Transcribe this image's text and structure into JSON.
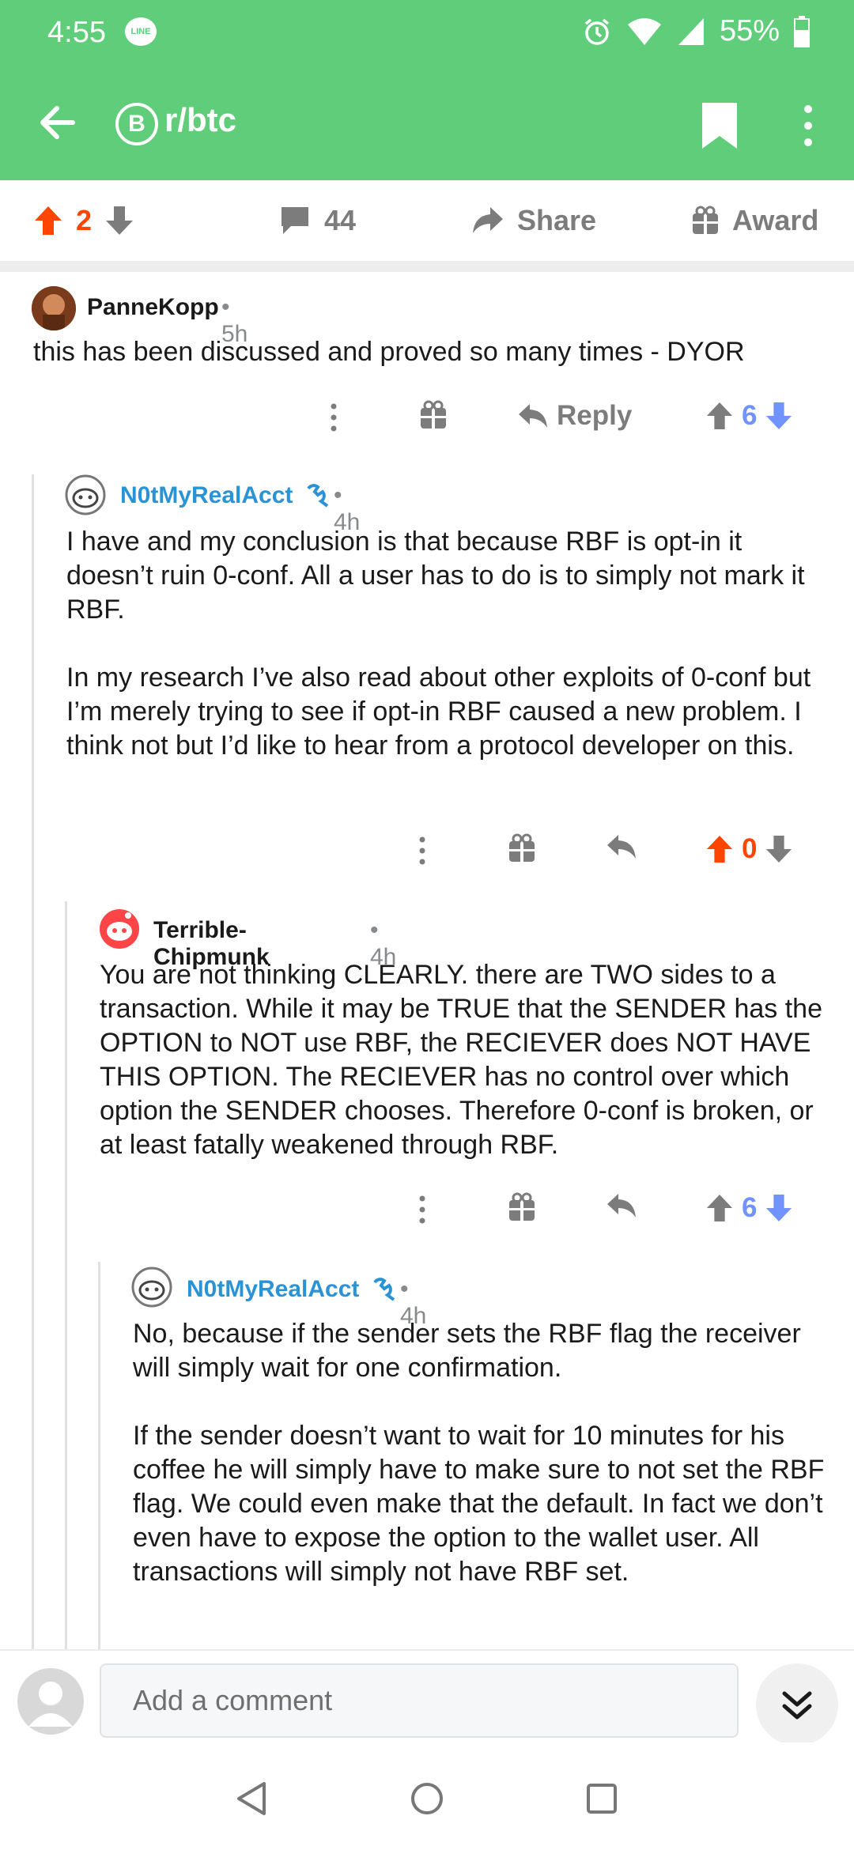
{
  "status": {
    "time": "4:55",
    "battery": "55%"
  },
  "header": {
    "subreddit": "r/btc",
    "subreddit_icon_letter": "B"
  },
  "post_actions": {
    "score": "2",
    "comments": "44",
    "share": "Share",
    "award": "Award"
  },
  "comments": [
    {
      "author": "PanneKopp",
      "age": "5h",
      "body": [
        "this has been discussed and proved so many times - DYOR"
      ],
      "reply_label": "Reply",
      "score": "6"
    },
    {
      "author": "N0tMyRealAcct",
      "age": "4h",
      "body": [
        "I have and my conclusion is that because RBF is opt-in it doesn’t ruin 0-conf. All a user has to do is to simply not mark it RBF.",
        "In my research I’ve also read about other exploits of 0-conf but I’m merely trying to see if opt-in RBF caused a new problem. I think not but I’d like to hear from a protocol developer on this."
      ],
      "score": "0"
    },
    {
      "author": "Terrible-Chipmunk",
      "age": "4h",
      "body": [
        "You are not thinking CLEARLY.  there are TWO sides to a transaction.  While it may be TRUE that the SENDER has the OPTION to NOT use RBF, the RECIEVER does NOT HAVE THIS OPTION.  The RECIEVER has no control over which option the SENDER chooses.  Therefore 0-conf is broken, or at least fatally weakened through RBF."
      ],
      "score": "6"
    },
    {
      "author": "N0tMyRealAcct",
      "age": "4h",
      "body": [
        "No, because if the sender sets the RBF flag the receiver will simply wait for one confirmation.",
        "If the sender doesn’t want to wait for 10 minutes for his coffee he will simply have to make sure to not set the RBF flag. We could even make that the default. In fact we don’t even have to expose the option to the wallet user. All transactions will simply not have RBF set."
      ]
    }
  ],
  "composer": {
    "placeholder": "Add a comment"
  },
  "colors": {
    "header_green": "#5fcd79",
    "upvote_orange": "#ff4500",
    "downvote_blue": "#7193ff",
    "op_blue": "#2a93d5"
  }
}
